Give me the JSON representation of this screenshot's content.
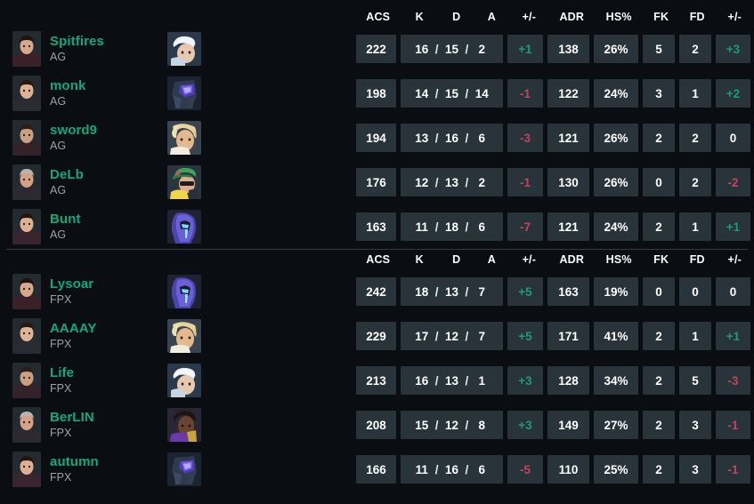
{
  "theme": {
    "background": "#0a0e12",
    "cell_background": "#28333a",
    "player_name_color": "#0fa97d",
    "team_tag_color": "#9aa3ab",
    "positive_color": "#1e9a7a",
    "negative_color": "#c0465a",
    "header_color": "#ffffff",
    "divider_color": "#343c42"
  },
  "columns": [
    {
      "key": "acs",
      "label": "ACS"
    },
    {
      "key": "k",
      "label": "K"
    },
    {
      "key": "d",
      "label": "D"
    },
    {
      "key": "a",
      "label": "A"
    },
    {
      "key": "pm1",
      "label": "+/-"
    },
    {
      "key": "adr",
      "label": "ADR"
    },
    {
      "key": "hs",
      "label": "HS%"
    },
    {
      "key": "fk",
      "label": "FK"
    },
    {
      "key": "fd",
      "label": "FD"
    },
    {
      "key": "pm2",
      "label": "+/-"
    }
  ],
  "teams": [
    {
      "tag": "AG",
      "headers": {
        "acs": "ACS",
        "k": "K",
        "d": "D",
        "a": "A",
        "pm1": "+/-",
        "adr": "ADR",
        "hs": "HS%",
        "fk": "FK",
        "fd": "FD",
        "pm2": "+/-"
      },
      "players": [
        {
          "name": "Spitfires",
          "team": "AG",
          "agent": "jett-agent-icon",
          "acs": "222",
          "k": "16",
          "d": "15",
          "a": "2",
          "kd_diff": "+1",
          "kd_diff_sign": "pos",
          "adr": "138",
          "hs": "26%",
          "fk": "5",
          "fd": "2",
          "fkfd_diff": "+3",
          "fkfd_diff_sign": "pos"
        },
        {
          "name": "monk",
          "team": "AG",
          "agent": "kayo-agent-icon",
          "acs": "198",
          "k": "14",
          "d": "15",
          "a": "14",
          "kd_diff": "-1",
          "kd_diff_sign": "neg",
          "adr": "122",
          "hs": "24%",
          "fk": "3",
          "fd": "1",
          "fkfd_diff": "+2",
          "fkfd_diff_sign": "pos"
        },
        {
          "name": "sword9",
          "team": "AG",
          "agent": "breach-agent-icon",
          "acs": "194",
          "k": "13",
          "d": "16",
          "a": "6",
          "kd_diff": "-3",
          "kd_diff_sign": "neg",
          "adr": "121",
          "hs": "26%",
          "fk": "2",
          "fd": "2",
          "fkfd_diff": "0",
          "fkfd_diff_sign": "zero"
        },
        {
          "name": "DeLb",
          "team": "AG",
          "agent": "killjoy-agent-icon",
          "acs": "176",
          "k": "12",
          "d": "13",
          "a": "2",
          "kd_diff": "-1",
          "kd_diff_sign": "neg",
          "adr": "130",
          "hs": "26%",
          "fk": "0",
          "fd": "2",
          "fkfd_diff": "-2",
          "fkfd_diff_sign": "neg"
        },
        {
          "name": "Bunt",
          "team": "AG",
          "agent": "omen-agent-icon",
          "acs": "163",
          "k": "11",
          "d": "18",
          "a": "6",
          "kd_diff": "-7",
          "kd_diff_sign": "neg",
          "adr": "121",
          "hs": "24%",
          "fk": "2",
          "fd": "1",
          "fkfd_diff": "+1",
          "fkfd_diff_sign": "pos"
        }
      ]
    },
    {
      "tag": "FPX",
      "headers": {
        "acs": "ACS",
        "k": "K",
        "d": "D",
        "a": "A",
        "pm1": "+/-",
        "adr": "ADR",
        "hs": "HS%",
        "fk": "FK",
        "fd": "FD",
        "pm2": "+/-"
      },
      "players": [
        {
          "name": "Lysoar",
          "team": "FPX",
          "agent": "omen-agent-icon",
          "acs": "242",
          "k": "18",
          "d": "13",
          "a": "7",
          "kd_diff": "+5",
          "kd_diff_sign": "pos",
          "adr": "163",
          "hs": "19%",
          "fk": "0",
          "fd": "0",
          "fkfd_diff": "0",
          "fkfd_diff_sign": "zero"
        },
        {
          "name": "AAAAY",
          "team": "FPX",
          "agent": "breach-agent-icon",
          "acs": "229",
          "k": "17",
          "d": "12",
          "a": "7",
          "kd_diff": "+5",
          "kd_diff_sign": "pos",
          "adr": "171",
          "hs": "41%",
          "fk": "2",
          "fd": "1",
          "fkfd_diff": "+1",
          "fkfd_diff_sign": "pos"
        },
        {
          "name": "Life",
          "team": "FPX",
          "agent": "jett-agent-icon",
          "acs": "213",
          "k": "16",
          "d": "13",
          "a": "1",
          "kd_diff": "+3",
          "kd_diff_sign": "pos",
          "adr": "128",
          "hs": "34%",
          "fk": "2",
          "fd": "5",
          "fkfd_diff": "-3",
          "fkfd_diff_sign": "neg"
        },
        {
          "name": "BerLIN",
          "team": "FPX",
          "agent": "skye-agent-icon",
          "acs": "208",
          "k": "15",
          "d": "12",
          "a": "8",
          "kd_diff": "+3",
          "kd_diff_sign": "pos",
          "adr": "149",
          "hs": "27%",
          "fk": "2",
          "fd": "3",
          "fkfd_diff": "-1",
          "fkfd_diff_sign": "neg"
        },
        {
          "name": "autumn",
          "team": "FPX",
          "agent": "kayo-agent-icon",
          "acs": "166",
          "k": "11",
          "d": "16",
          "a": "6",
          "kd_diff": "-5",
          "kd_diff_sign": "neg",
          "adr": "110",
          "hs": "25%",
          "fk": "2",
          "fd": "3",
          "fkfd_diff": "-1",
          "fkfd_diff_sign": "neg"
        }
      ]
    }
  ]
}
